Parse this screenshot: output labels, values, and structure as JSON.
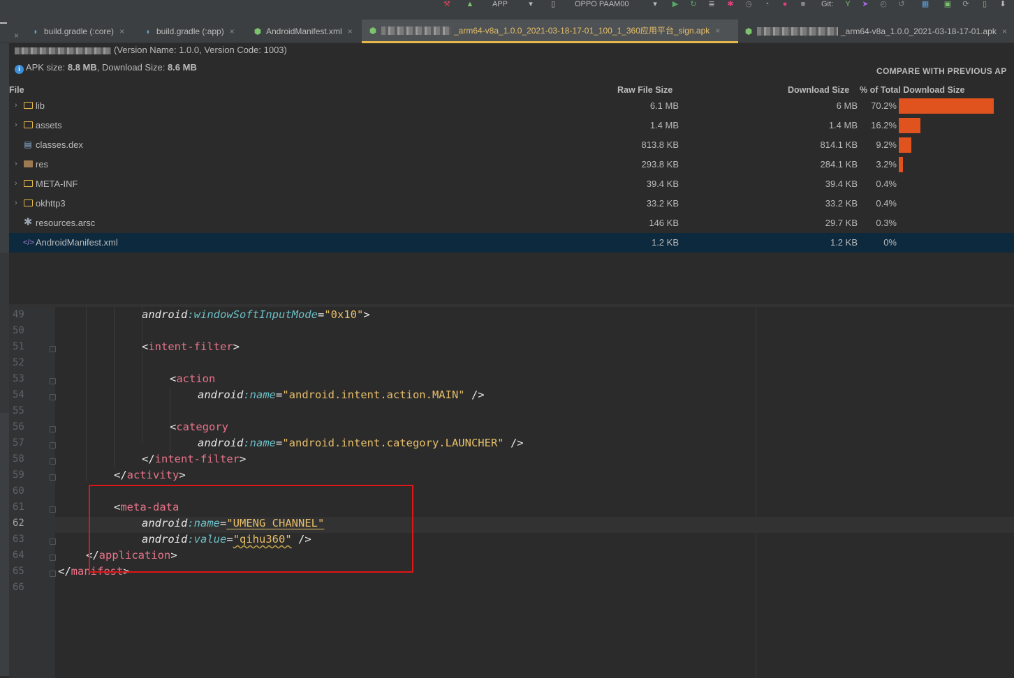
{
  "toolbar": {
    "config": "APP",
    "device": "OPPO PAAM00",
    "git_label": "Git:"
  },
  "tabs": [
    {
      "label": "build.gradle (:core)",
      "icon": "gradle-elephant-icon"
    },
    {
      "label": "build.gradle (:app)",
      "icon": "gradle-elephant-icon"
    },
    {
      "label": "AndroidManifest.xml",
      "icon": "android-icon"
    },
    {
      "label": "_arm64-v8a_1.0.0_2021-03-18-17-01_100_1_360应用平台_sign.apk",
      "icon": "android-icon",
      "active": true
    },
    {
      "label": "_arm64-v8a_1.0.0_2021-03-18-17-01.apk",
      "icon": "android-icon"
    }
  ],
  "apk": {
    "version_line": "(Version Name: 1.0.0, Version Code: 1003)",
    "size_prefix": "APK size: ",
    "apk_size": "8.8 MB",
    "download_prefix": ", Download Size: ",
    "download_size": "8.6 MB",
    "compare_label": "COMPARE WITH PREVIOUS AP",
    "columns": {
      "file": "File",
      "raw": "Raw File Size",
      "download": "Download Size",
      "percent": "% of Total Download Size"
    },
    "rows": [
      {
        "name": "lib",
        "type": "folder",
        "expandable": true,
        "raw": "6.1 MB",
        "download": "6 MB",
        "percent": "70.2%",
        "fraction": 0.702
      },
      {
        "name": "assets",
        "type": "folder",
        "expandable": true,
        "raw": "1.4 MB",
        "download": "1.4 MB",
        "percent": "16.2%",
        "fraction": 0.162
      },
      {
        "name": "classes.dex",
        "type": "dex",
        "expandable": false,
        "raw": "813.8 KB",
        "download": "814.1 KB",
        "percent": "9.2%",
        "fraction": 0.092
      },
      {
        "name": "res",
        "type": "res-folder",
        "expandable": true,
        "raw": "293.8 KB",
        "download": "284.1 KB",
        "percent": "3.2%",
        "fraction": 0.032
      },
      {
        "name": "META-INF",
        "type": "folder",
        "expandable": true,
        "raw": "39.4 KB",
        "download": "39.4 KB",
        "percent": "0.4%",
        "fraction": 0.004
      },
      {
        "name": "okhttp3",
        "type": "folder",
        "expandable": true,
        "raw": "33.2 KB",
        "download": "33.2 KB",
        "percent": "0.4%",
        "fraction": 0.004
      },
      {
        "name": "resources.arsc",
        "type": "arsc",
        "expandable": false,
        "raw": "146 KB",
        "download": "29.7 KB",
        "percent": "0.3%",
        "fraction": 0.003
      },
      {
        "name": "AndroidManifest.xml",
        "type": "xml",
        "expandable": false,
        "raw": "1.2 KB",
        "download": "1.2 KB",
        "percent": "0%",
        "fraction": 0.0,
        "selected": true
      }
    ]
  },
  "editor": {
    "current_line": 62,
    "lines": [
      {
        "n": "49",
        "text": [
          "android",
          ":",
          "windowSoftInputMode",
          "=",
          "\"0x10\"",
          ">"
        ]
      },
      {
        "n": "50"
      },
      {
        "n": "51",
        "text": [
          "<",
          "intent-filter",
          ">"
        ]
      },
      {
        "n": "52"
      },
      {
        "n": "53",
        "text": [
          "<",
          "action"
        ]
      },
      {
        "n": "54",
        "text": [
          "android",
          ":",
          "name",
          "=",
          "\"android.intent.action.MAIN\"",
          " />"
        ]
      },
      {
        "n": "55"
      },
      {
        "n": "56",
        "text": [
          "<",
          "category"
        ]
      },
      {
        "n": "57",
        "text": [
          "android",
          ":",
          "name",
          "=",
          "\"android.intent.category.LAUNCHER\"",
          " />"
        ]
      },
      {
        "n": "58",
        "text": [
          "</",
          "intent-filter",
          ">"
        ]
      },
      {
        "n": "59",
        "text": [
          "</",
          "activity",
          ">"
        ]
      },
      {
        "n": "60"
      },
      {
        "n": "61",
        "text": [
          "<",
          "meta-data"
        ]
      },
      {
        "n": "62",
        "text": [
          "android",
          ":",
          "name",
          "=",
          "\"UMENG_CHANNEL\""
        ]
      },
      {
        "n": "63",
        "text": [
          "android",
          ":",
          "value",
          "=",
          "\"qihu360\"",
          " />"
        ]
      },
      {
        "n": "64",
        "text": [
          "</",
          "application",
          ">"
        ]
      },
      {
        "n": "65",
        "text": [
          "</",
          "manifest",
          ">"
        ]
      },
      {
        "n": "66"
      }
    ]
  },
  "colors": {
    "accent_tab": "#e6b74b",
    "bar": "#e0531f",
    "highlight_box": "#e01515",
    "selection": "#0d293e"
  }
}
